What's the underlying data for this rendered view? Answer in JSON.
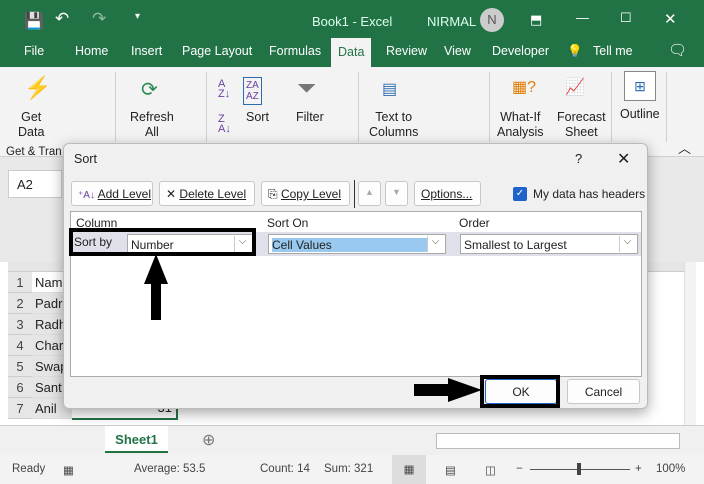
{
  "titlebar": {
    "title": "Book1  -  Excel",
    "user": "NIRMAL",
    "avatar": "N"
  },
  "tabs": [
    "File",
    "Home",
    "Insert",
    "Page Layout",
    "Formulas",
    "Data",
    "Review",
    "View",
    "Developer",
    "Tell me"
  ],
  "ribbon": {
    "get_data": "Get",
    "get_data2": "Data",
    "refresh": "Refresh",
    "refresh2": "All",
    "sort": "Sort",
    "filter": "Filter",
    "text_to": "Text to",
    "columns": "Columns",
    "what_if": "What-If",
    "analysis": "Analysis",
    "forecast": "Forecast",
    "sheet": "Sheet",
    "outline": "Outline",
    "group_label": "Get & Tran"
  },
  "name_box": "A2",
  "rows": [
    {
      "n": "1",
      "v": "Nam"
    },
    {
      "n": "2",
      "v": "Padr"
    },
    {
      "n": "3",
      "v": "Radh"
    },
    {
      "n": "4",
      "v": "Char"
    },
    {
      "n": "5",
      "v": "Swap"
    },
    {
      "n": "6",
      "v": "Sant"
    },
    {
      "n": "7",
      "v": "Anil"
    }
  ],
  "row7_value": "31",
  "sheet_tab": "Sheet1",
  "status": {
    "ready": "Ready",
    "average": "Average: 53.5",
    "count": "Count: 14",
    "sum": "Sum: 321",
    "zoom": "100%"
  },
  "dialog": {
    "title": "Sort",
    "help": "?",
    "add_level": "Add Level",
    "delete_level": "Delete Level",
    "copy_level": "Copy Level",
    "options": "Options...",
    "headers_label": "My data has headers",
    "headers_checked": true,
    "col_header": "Column",
    "sorton_header": "Sort On",
    "order_header": "Order",
    "sort_by": "Sort by",
    "column_value": "Number",
    "sorton_value": "Cell Values",
    "order_value": "Smallest to Largest",
    "ok": "OK",
    "cancel": "Cancel"
  }
}
